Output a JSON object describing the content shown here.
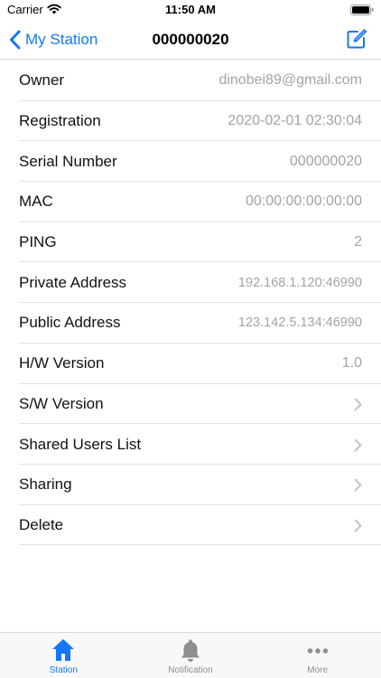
{
  "status_bar": {
    "carrier": "Carrier",
    "time": "11:50 AM"
  },
  "nav": {
    "back_label": "My Station",
    "title": "000000020"
  },
  "rows": [
    {
      "label": "Owner",
      "value": "dinobei89@gmail.com"
    },
    {
      "label": "Registration",
      "value": "2020-02-01 02:30:04"
    },
    {
      "label": "Serial Number",
      "value": "000000020"
    },
    {
      "label": "MAC",
      "value": "00:00:00:00:00:00"
    },
    {
      "label": "PING",
      "value": "2"
    },
    {
      "label": "Private Address",
      "value": "192.168.1.120:46990"
    },
    {
      "label": "Public Address",
      "value": "123.142.5.134:46990"
    },
    {
      "label": "H/W Version",
      "value": "1.0"
    },
    {
      "label": "S/W Version"
    },
    {
      "label": "Shared Users List"
    },
    {
      "label": "Sharing"
    },
    {
      "label": "Delete"
    }
  ],
  "tabs": [
    {
      "label": "Station",
      "icon": "home-icon",
      "active": true
    },
    {
      "label": "Notification",
      "icon": "bell-icon",
      "active": false
    },
    {
      "label": "More",
      "icon": "more-icon",
      "active": false
    }
  ],
  "colors": {
    "accent": "#1477f8",
    "secondary_text": "#a3a3a8",
    "inactive_tab": "#8e8e93"
  }
}
